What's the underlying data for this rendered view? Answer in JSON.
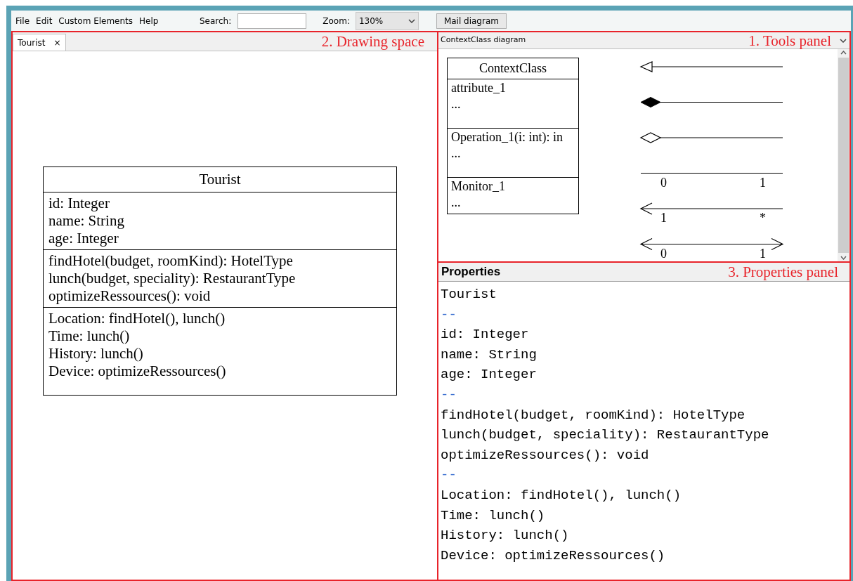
{
  "menu": [
    "File",
    "Edit",
    "Custom Elements",
    "Help"
  ],
  "search": {
    "label": "Search:"
  },
  "zoom": {
    "label": "Zoom:",
    "value": "130%"
  },
  "mail_button": "Mail diagram",
  "drawing_space": {
    "annotation": "2. Drawing space",
    "tabs": [
      {
        "label": "Tourist",
        "close": "×",
        "selected": true
      }
    ],
    "class": {
      "name": "Tourist",
      "sections": [
        [
          "id: Integer",
          "name: String",
          "age: Integer"
        ],
        [
          "findHotel(budget, roomKind): HotelType",
          "lunch(budget, speciality): RestaurantType",
          "optimizeRessources(): void"
        ],
        [
          "Location: findHotel(), lunch()",
          "Time: lunch()",
          "History: lunch()",
          "Device: optimizeRessources()"
        ]
      ]
    }
  },
  "tools_panel": {
    "title": "ContextClass diagram",
    "annotation": "1. Tools panel",
    "class": {
      "name": "ContextClass",
      "sections": [
        [
          "attribute_1",
          "..."
        ],
        [
          "Operation_1(i: int): in",
          "..."
        ],
        [
          "Monitor_1",
          "..."
        ]
      ]
    },
    "tools": [
      {
        "kind": "generalization"
      },
      {
        "kind": "composition"
      },
      {
        "kind": "aggregation"
      },
      {
        "kind": "association",
        "left_label": "0",
        "right_label": "1"
      },
      {
        "kind": "directed",
        "left_label": "1",
        "right_label": "*"
      },
      {
        "kind": "bidirectional",
        "left_label": "0",
        "right_label": "1"
      }
    ]
  },
  "properties": {
    "title": "Properties",
    "annotation": "3. Properties panel",
    "lines": [
      {
        "kind": "text",
        "text": "Tourist"
      },
      {
        "kind": "separator",
        "text": "--"
      },
      {
        "kind": "text",
        "text": "id: Integer"
      },
      {
        "kind": "text",
        "text": "name: String"
      },
      {
        "kind": "text",
        "text": "age: Integer"
      },
      {
        "kind": "separator",
        "text": "--"
      },
      {
        "kind": "text",
        "text": "findHotel(budget, roomKind): HotelType"
      },
      {
        "kind": "text",
        "text": "lunch(budget, speciality): RestaurantType"
      },
      {
        "kind": "text",
        "text": "optimizeRessources(): void"
      },
      {
        "kind": "separator",
        "text": "--"
      },
      {
        "kind": "text",
        "text": "Location: findHotel(), lunch()"
      },
      {
        "kind": "text",
        "text": "Time: lunch()"
      },
      {
        "kind": "text",
        "text": "History: lunch()"
      },
      {
        "kind": "text",
        "text": "Device: optimizeRessources()"
      }
    ]
  }
}
